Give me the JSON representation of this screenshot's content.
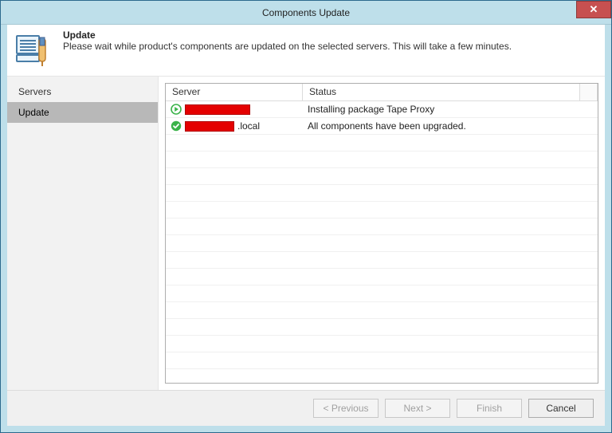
{
  "window": {
    "title": "Components Update"
  },
  "header": {
    "title": "Update",
    "subtitle": "Please wait while product's components are updated on the selected servers. This will take a few minutes."
  },
  "sidebar": {
    "items": [
      {
        "label": "Servers",
        "active": false
      },
      {
        "label": "Update",
        "active": true
      }
    ]
  },
  "grid": {
    "columns": {
      "server": "Server",
      "status": "Status"
    },
    "rows": [
      {
        "icon": "running",
        "server_redacted_width": 82,
        "server_suffix": "",
        "status": "Installing package Tape Proxy"
      },
      {
        "icon": "success",
        "server_redacted_width": 62,
        "server_suffix": ".local",
        "status": "All components have been upgraded."
      }
    ]
  },
  "buttons": {
    "previous": "< Previous",
    "next": "Next >",
    "finish": "Finish",
    "cancel": "Cancel"
  }
}
